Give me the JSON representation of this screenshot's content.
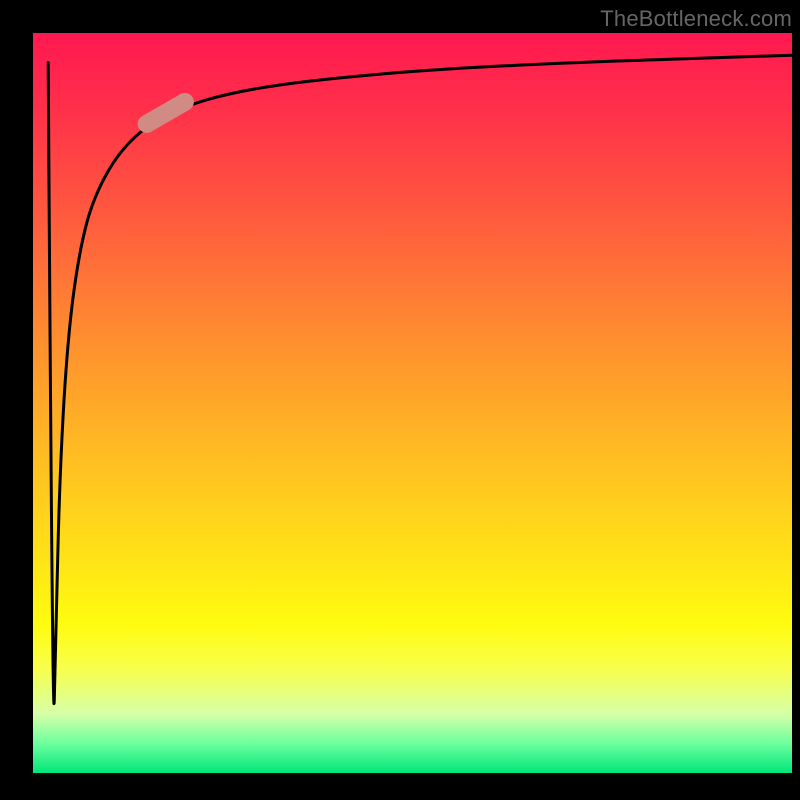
{
  "watermark": "TheBottleneck.com",
  "chart_data": {
    "type": "line",
    "title": "",
    "xlabel": "",
    "ylabel": "",
    "xlim": [
      0,
      100
    ],
    "ylim": [
      0,
      100
    ],
    "grid": false,
    "legend": false,
    "series": [
      {
        "name": "curve",
        "points": [
          {
            "x": 2.0,
            "y": 96.0
          },
          {
            "x": 2.6,
            "y": 2.0
          },
          {
            "x": 3.0,
            "y": 18.0
          },
          {
            "x": 3.5,
            "y": 40.0
          },
          {
            "x": 4.5,
            "y": 58.0
          },
          {
            "x": 6.0,
            "y": 70.0
          },
          {
            "x": 8.0,
            "y": 78.0
          },
          {
            "x": 12.0,
            "y": 85.0
          },
          {
            "x": 18.0,
            "y": 89.5
          },
          {
            "x": 28.0,
            "y": 92.5
          },
          {
            "x": 45.0,
            "y": 94.5
          },
          {
            "x": 65.0,
            "y": 95.8
          },
          {
            "x": 100.0,
            "y": 97.0
          }
        ]
      }
    ],
    "highlight": {
      "center": {
        "x": 17.5,
        "y": 89.2
      },
      "angle_deg": 30
    },
    "gradient_stops": [
      {
        "pct": 0,
        "color": "#ff1850"
      },
      {
        "pct": 25,
        "color": "#ff5b3e"
      },
      {
        "pct": 55,
        "color": "#ffb724"
      },
      {
        "pct": 80,
        "color": "#fffc10"
      },
      {
        "pct": 100,
        "color": "#00e67a"
      }
    ]
  }
}
